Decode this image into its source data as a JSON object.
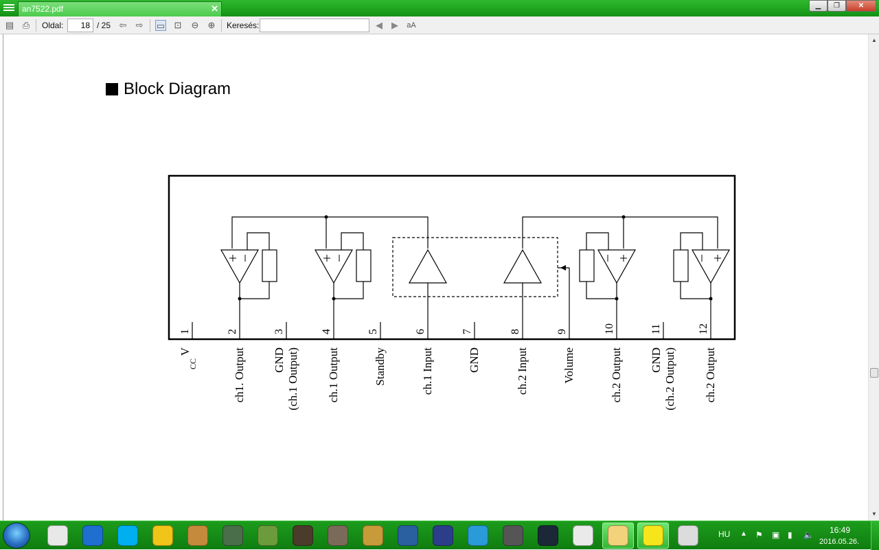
{
  "window": {
    "tab_title": "an7522.pdf",
    "close_tab": "✕"
  },
  "toolbar": {
    "page_label": "Oldal:",
    "page_value": "18",
    "page_total": "/ 25",
    "search_label": "Keresés:",
    "search_value": "",
    "font_icon_label": "aA"
  },
  "document": {
    "section_title": "Block Diagram",
    "pin_numbers": [
      "1",
      "2",
      "3",
      "4",
      "5",
      "6",
      "7",
      "8",
      "9",
      "10",
      "11",
      "12"
    ],
    "pin_labels": [
      [
        "V",
        "CC"
      ],
      [
        "ch1. Output"
      ],
      [
        "GND",
        "(ch.1 Output)"
      ],
      [
        "ch.1 Output"
      ],
      [
        "Standby"
      ],
      [
        "ch.1 Input"
      ],
      [
        "GND"
      ],
      [
        "ch.2 Input"
      ],
      [
        "Volume"
      ],
      [
        "ch.2 Output"
      ],
      [
        "GND",
        "(ch.2 Output)"
      ],
      [
        "ch.2 Output"
      ]
    ]
  },
  "taskbar": {
    "apps": [
      {
        "name": "chrome",
        "icon": "chrome-icon"
      },
      {
        "name": "maxthon",
        "icon": "maxthon-icon"
      },
      {
        "name": "skype",
        "icon": "skype-icon"
      },
      {
        "name": "aimp",
        "icon": "aimp-icon"
      },
      {
        "name": "game-avatar",
        "icon": "game-avatar-icon"
      },
      {
        "name": "power-app",
        "icon": "power-icon"
      },
      {
        "name": "minecraft",
        "icon": "minecraft-icon"
      },
      {
        "name": "shield-game",
        "icon": "shield-game-icon"
      },
      {
        "name": "house-game",
        "icon": "house-icon"
      },
      {
        "name": "hearthstone",
        "icon": "hearthstone-icon"
      },
      {
        "name": "visual-studio",
        "icon": "visual-studio-icon"
      },
      {
        "name": "notepad",
        "icon": "notepad-icon"
      },
      {
        "name": "thunderbird",
        "icon": "thunderbird-icon"
      },
      {
        "name": "camera-app",
        "icon": "camera-icon"
      },
      {
        "name": "steam",
        "icon": "steam-icon"
      },
      {
        "name": "calculator",
        "icon": "calculator-icon"
      },
      {
        "name": "explorer",
        "icon": "folder-icon"
      },
      {
        "name": "pdf-viewer",
        "icon": "pdf-icon"
      },
      {
        "name": "speaker-app",
        "icon": "speaker-icon"
      }
    ],
    "language": "HU",
    "time": "16:49",
    "date": "2016.05.26."
  }
}
